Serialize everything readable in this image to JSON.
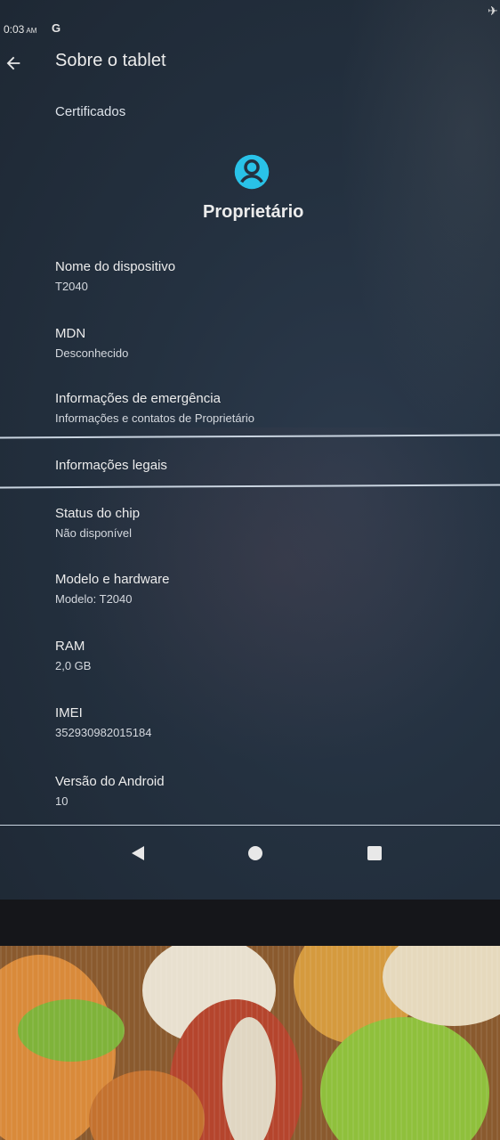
{
  "status_bar": {
    "time": "0:03",
    "ampm": "AM",
    "indicator": "G"
  },
  "app_bar": {
    "title": "Sobre o tablet",
    "back_icon": "arrow-back-icon"
  },
  "links": {
    "certificates": "Certificados",
    "legal": "Informações legais"
  },
  "owner": {
    "name": "Proprietário",
    "icon": "account-circle-icon",
    "icon_color": "#29c2e8"
  },
  "prefs": [
    {
      "title": "Nome do dispositivo",
      "summary": "T2040"
    },
    {
      "title": "MDN",
      "summary": "Desconhecido"
    },
    {
      "title": "Informações de emergência",
      "summary": "Informações e contatos de Proprietário"
    },
    {
      "title": "Status do chip",
      "summary": "Não disponível"
    },
    {
      "title": "Modelo e hardware",
      "summary": "Modelo: T2040"
    },
    {
      "title": "RAM",
      "summary": "2,0 GB"
    },
    {
      "title": "IMEI",
      "summary": "352930982015184"
    },
    {
      "title": "Versão do Android",
      "summary": "10"
    }
  ],
  "nav_bar": {
    "back": "nav-back-icon",
    "home": "nav-home-icon",
    "recents": "nav-recents-icon"
  }
}
